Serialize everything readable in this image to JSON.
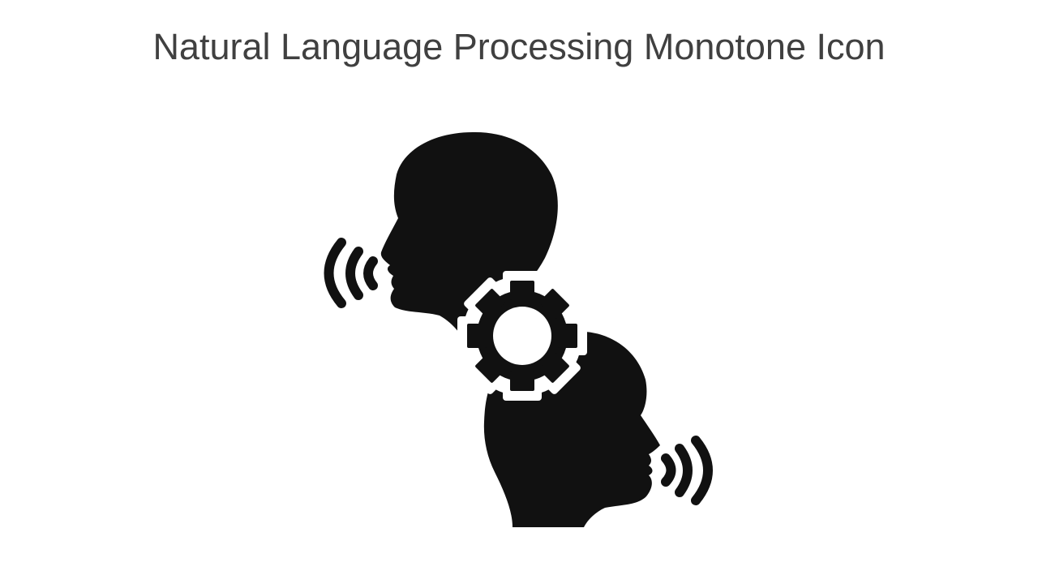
{
  "slide": {
    "title": "Natural Language Processing Monotone Icon"
  },
  "icon": {
    "name": "natural-language-processing-icon",
    "style": "monotone",
    "fill_color": "#111111",
    "background_color": "#ffffff",
    "parts": [
      "speaking-head-icon",
      "gear-icon",
      "listening-head-icon",
      "sound-waves-icon"
    ]
  },
  "theme": {
    "title_color": "#404040"
  }
}
